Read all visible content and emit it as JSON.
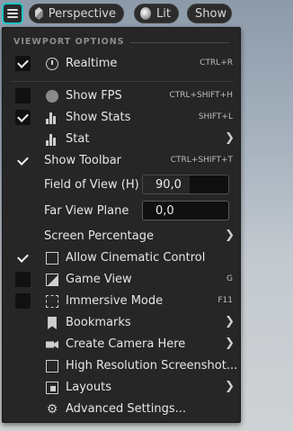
{
  "toolbar": {
    "perspective_label": "Perspective",
    "lit_label": "Lit",
    "show_label": "Show"
  },
  "menu": {
    "section_header": "VIEWPORT OPTIONS",
    "realtime": {
      "label": "Realtime",
      "shortcut": "CTRL+R",
      "checked": true,
      "icon": "stopwatch-icon"
    },
    "show_fps": {
      "label": "Show FPS",
      "shortcut": "CTRL+SHIFT+H",
      "checked": false,
      "icon": "gauge-icon"
    },
    "show_stats": {
      "label": "Show Stats",
      "shortcut": "SHIFT+L",
      "checked": true,
      "icon": "bar-chart-icon"
    },
    "stat": {
      "label": "Stat",
      "icon": "bar-chart-icon",
      "submenu": true
    },
    "show_toolbar": {
      "label": "Show Toolbar",
      "shortcut": "CTRL+SHIFT+T",
      "checked": true
    },
    "field_of_view": {
      "label": "Field of View (H)",
      "value": "90,0"
    },
    "far_view_plane": {
      "label": "Far View Plane",
      "value": "0,0"
    },
    "screen_percentage": {
      "label": "Screen Percentage",
      "submenu": true
    },
    "allow_cinematic": {
      "label": "Allow Cinematic Control",
      "checked": true,
      "icon": "film-icon"
    },
    "game_view": {
      "label": "Game View",
      "shortcut": "G",
      "checked": false,
      "icon": "image-icon"
    },
    "immersive_mode": {
      "label": "Immersive Mode",
      "shortcut": "F11",
      "checked": false,
      "icon": "fullscreen-icon"
    },
    "bookmarks": {
      "label": "Bookmarks",
      "icon": "bookmark-icon",
      "submenu": true
    },
    "create_camera": {
      "label": "Create Camera Here",
      "icon": "camera-add-icon",
      "submenu": true
    },
    "high_res_screenshot": {
      "label": "High Resolution Screenshot...",
      "icon": "screenshot-icon"
    },
    "layouts": {
      "label": "Layouts",
      "icon": "layout-icon",
      "submenu": true
    },
    "advanced_settings": {
      "label": "Advanced Settings...",
      "icon": "gear-icon"
    }
  },
  "colors": {
    "accent": "#1fc6c6",
    "panel": "#262626"
  }
}
